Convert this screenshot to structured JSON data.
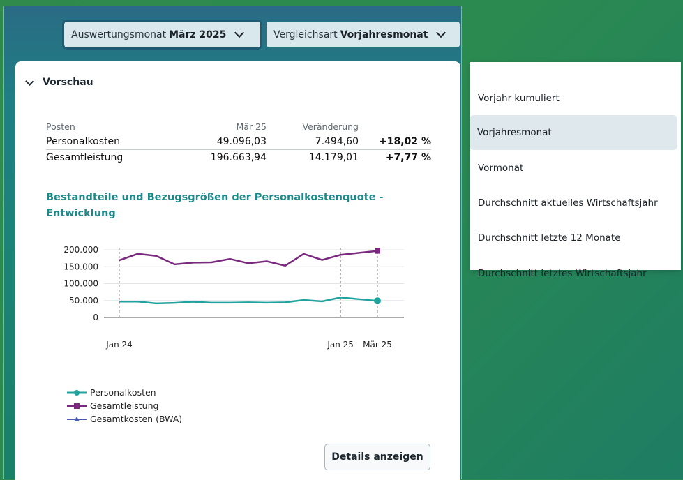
{
  "toolbar": {
    "month_label": "Auswertungsmonat",
    "month_value": "März 2025",
    "compare_label": "Vergleichsart",
    "compare_value": "Vorjahresmonat"
  },
  "preview": {
    "heading": "Vorschau",
    "columns": [
      "Posten",
      "Mär 25",
      "Veränderung",
      ""
    ],
    "rows": [
      {
        "name": "Personalkosten",
        "value": "49.096,03",
        "change": "7.494,60",
        "pct": "+18,02 %"
      },
      {
        "name": "Gesamtleistung",
        "value": "196.663,94",
        "change": "14.179,01",
        "pct": "+7,77 %"
      }
    ]
  },
  "chart_data": {
    "type": "line",
    "title": "Bestandteile und Bezugsgrößen der Personalkostenquote - Entwicklung",
    "x": [
      "Jan 24",
      "Feb 24",
      "Mär 24",
      "Apr 24",
      "Mai 24",
      "Jun 24",
      "Jul 24",
      "Aug 24",
      "Sep 24",
      "Okt 24",
      "Nov 24",
      "Dez 24",
      "Jan 25",
      "Feb 25",
      "Mär 25"
    ],
    "x_tick_labels": [
      "Jan 24",
      "Jan 25",
      "Mär 25"
    ],
    "y_ticks": [
      "200.000",
      "150.000",
      "100.000",
      "50.000",
      "0"
    ],
    "ylim": [
      0,
      200000
    ],
    "series": [
      {
        "name": "Personalkosten",
        "color": "#20a39e",
        "marker": "circle",
        "values": [
          47000,
          47000,
          41500,
          43000,
          46500,
          43500,
          43500,
          44500,
          43500,
          44500,
          51500,
          47500,
          59000,
          54000,
          49096
        ]
      },
      {
        "name": "Gesamtleistung",
        "color": "#7a2a7e",
        "marker": "square",
        "values": [
          169000,
          188000,
          182000,
          157000,
          162000,
          163000,
          173000,
          160000,
          166000,
          153000,
          188000,
          170000,
          185000,
          191000,
          196664
        ]
      },
      {
        "name": "Gesamtkosten (BWA)",
        "color": "#4a5ab5",
        "marker": "triangle",
        "hidden": true,
        "values": []
      }
    ],
    "highlight_x": [
      "Jan 24",
      "Jan 25",
      "Mär 25"
    ]
  },
  "details_button": "Details anzeigen",
  "compare_options": {
    "items": [
      "Vorjahr kumuliert",
      "Vorjahresmonat",
      "Vormonat",
      "Durchschnitt aktuelles Wirtschaftsjahr",
      "Durchschnitt letzte 12 Monate",
      "Durchschnitt letztes Wirtschaftsjahr"
    ],
    "selected": 1
  }
}
